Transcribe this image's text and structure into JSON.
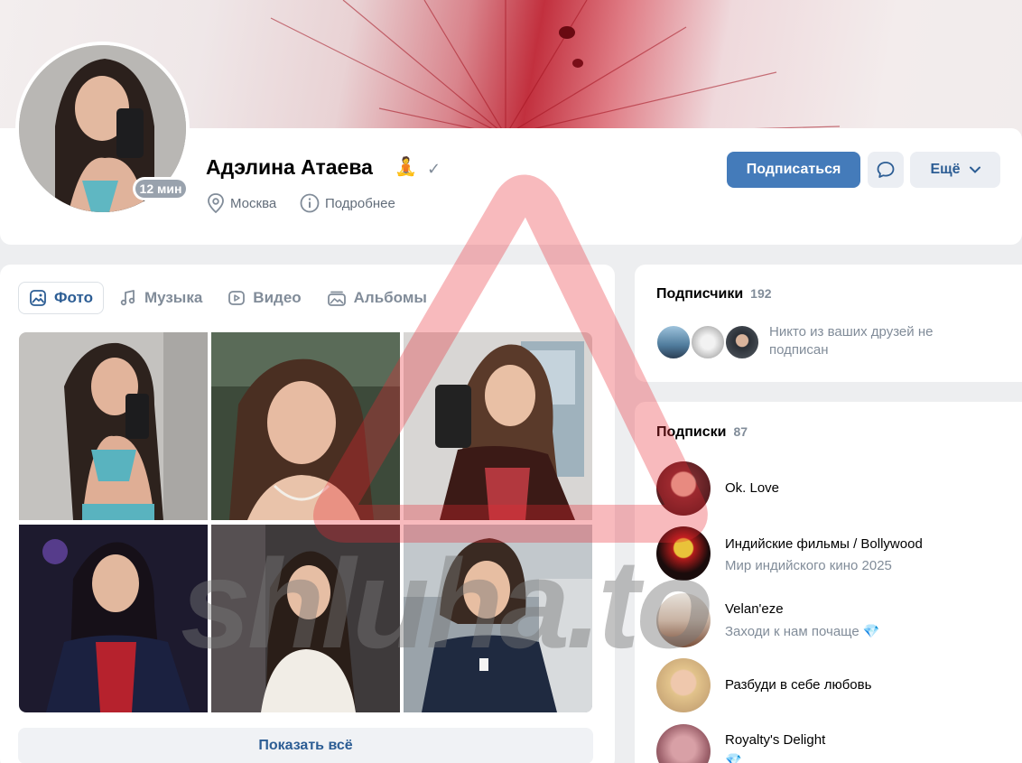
{
  "profile": {
    "name": "Адэлина Атаева",
    "status_emoji": "🧘",
    "online_badge": "12 мин",
    "city": "Москва",
    "details_link": "Подробнее",
    "verified_icon": "check-icon"
  },
  "actions": {
    "subscribe": "Подписаться",
    "more": "Ещё"
  },
  "tabs": [
    {
      "label": "Фото",
      "icon": "image-icon",
      "active": true
    },
    {
      "label": "Музыка",
      "icon": "music-icon",
      "active": false
    },
    {
      "label": "Видео",
      "icon": "video-icon",
      "active": false
    },
    {
      "label": "Альбомы",
      "icon": "albums-icon",
      "active": false
    }
  ],
  "photos_show_all": "Показать всё",
  "followers": {
    "title": "Подписчики",
    "count": "192",
    "note": "Никто из ваших друзей не подписан"
  },
  "subscriptions": {
    "title": "Подписки",
    "count": "87",
    "items": [
      {
        "name": "Ok. Love",
        "desc": ""
      },
      {
        "name": "Индийские фильмы / Bollywood",
        "desc": "Мир индийского кино 2025"
      },
      {
        "name": "Velan'eze",
        "desc": "Заходи к нам почаще 💎"
      },
      {
        "name": "Разбуди в себе любовь",
        "desc": ""
      },
      {
        "name": "Royalty's Delight",
        "desc": "💎"
      }
    ]
  },
  "watermark": "shluha.to",
  "colors": {
    "accent": "#447bba",
    "link": "#2c5d94",
    "secondary_text": "#818c99",
    "page_bg": "#edeef0"
  }
}
